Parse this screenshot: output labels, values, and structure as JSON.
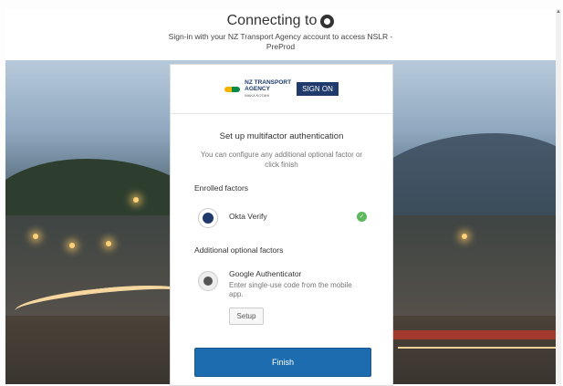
{
  "header": {
    "title": "Connecting to",
    "subtitle": "Sign-in with your NZ Transport Agency account to access NSLR - PreProd"
  },
  "brand": {
    "logo_line1": "NZ TRANSPORT",
    "logo_line2": "AGENCY",
    "logo_small": "WAKA KOTAHI",
    "signon": "SIGN ON"
  },
  "card": {
    "heading": "Set up multifactor authentication",
    "description": "You can configure any additional optional factor or click finish",
    "enrolled_title": "Enrolled factors",
    "enrolled": [
      {
        "name": "Okta Verify",
        "status": "enrolled",
        "icon": "okta-verify-icon"
      }
    ],
    "optional_title": "Additional optional factors",
    "optional": [
      {
        "name": "Google Authenticator",
        "description": "Enter single-use code from the mobile app.",
        "button": "Setup",
        "icon": "google-authenticator-icon"
      }
    ],
    "finish_label": "Finish"
  },
  "colors": {
    "primary": "#1e6cb0",
    "brand_navy": "#1f3a6b",
    "success": "#5cb85c"
  }
}
